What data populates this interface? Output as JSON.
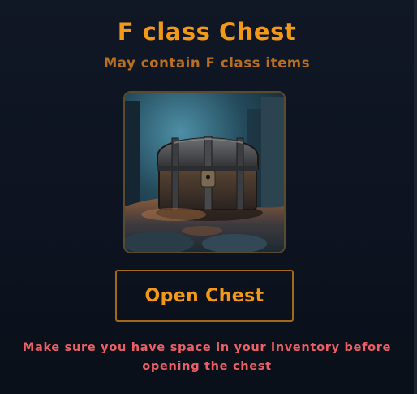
{
  "chest": {
    "title": "F class Chest",
    "subtitle": "May contain F class items",
    "image_icon": "treasure-chest-icon",
    "open_button_label": "Open Chest",
    "warning": "Make sure you have space in your inventory before opening the chest"
  },
  "colors": {
    "background": "#0e1422",
    "accent": "#f29a17",
    "subtitle": "#b96f1f",
    "button_border": "#a3691a",
    "warning": "#ec5f66"
  }
}
